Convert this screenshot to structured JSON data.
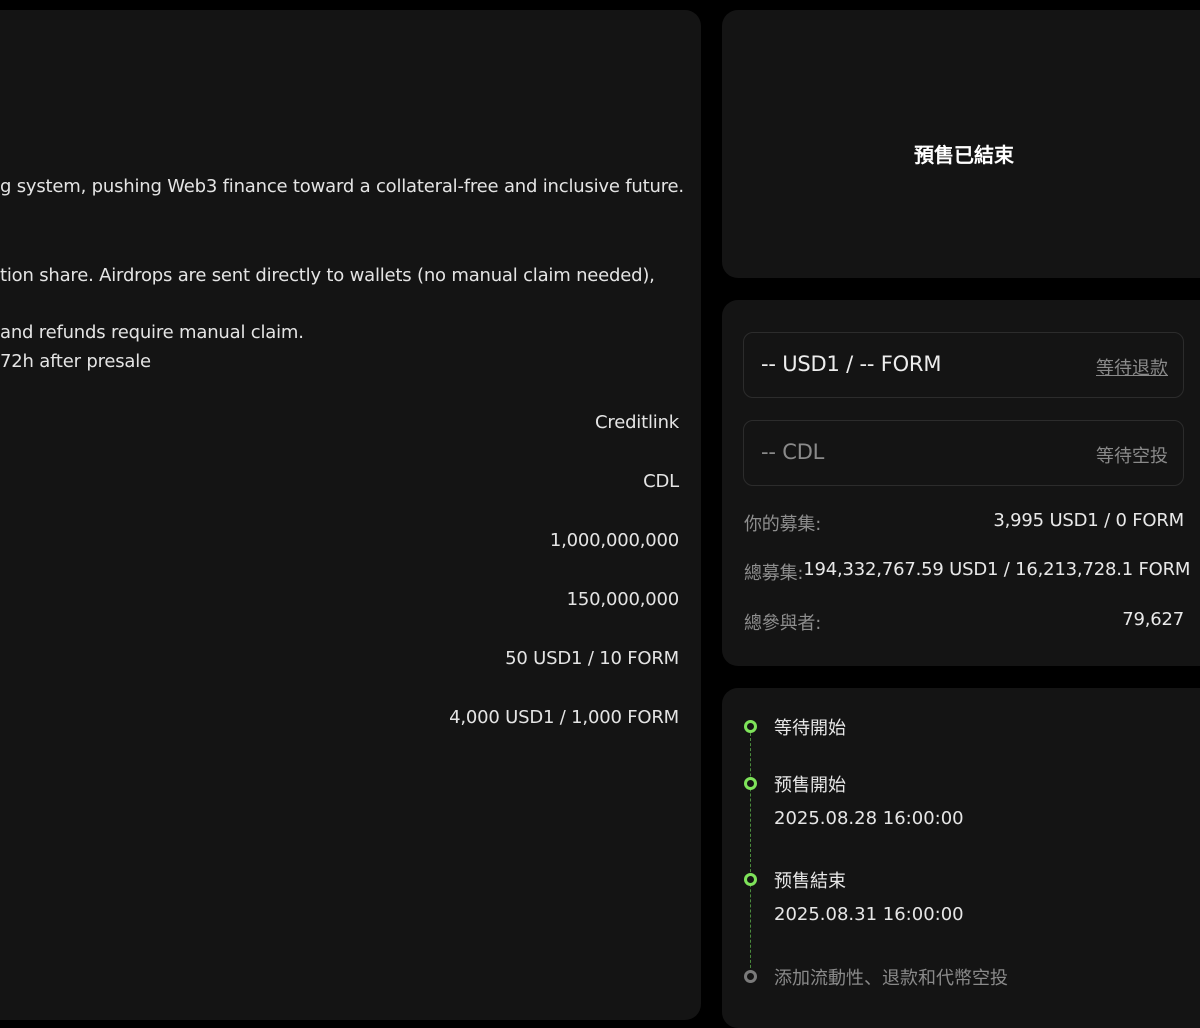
{
  "project_info": {
    "description_lines": [
      "g system, pushing Web3 finance toward a collateral-free and inclusive future.",
      "tion share. Airdrops are sent directly to wallets (no manual claim needed),",
      "and refunds require manual claim.",
      "72h after presale"
    ],
    "values": [
      "Creditlink",
      "CDL",
      "1,000,000,000",
      "150,000,000",
      "50 USD1 / 10 FORM",
      "4,000 USD1 / 1,000 FORM"
    ]
  },
  "status": {
    "title": "預售已結束"
  },
  "claim": {
    "refund": {
      "amount": "-- USD1 / -- FORM",
      "action": "等待退款"
    },
    "airdrop": {
      "amount": "-- CDL",
      "action": "等待空投"
    },
    "stats": [
      {
        "label": "你的募集:",
        "value": "3,995 USD1 / 0 FORM"
      },
      {
        "label": "總募集:",
        "value": "194,332,767.59 USD1 / 16,213,728.1 FORM"
      },
      {
        "label": "總參與者:",
        "value": "79,627"
      }
    ]
  },
  "timeline": {
    "steps": [
      {
        "label": "等待開始",
        "date": "",
        "state": "done"
      },
      {
        "label": "预售開始",
        "date": "2025.08.28 16:00:00",
        "state": "done"
      },
      {
        "label": "预售結束",
        "date": "2025.08.31 16:00:00",
        "state": "done"
      },
      {
        "label": "添加流動性、退款和代幣空投",
        "date": "",
        "state": "pending"
      }
    ]
  },
  "colors": {
    "background": "#000000",
    "card": "#141414",
    "accent_green": "#7ee35a",
    "muted": "#8a8a8a"
  }
}
